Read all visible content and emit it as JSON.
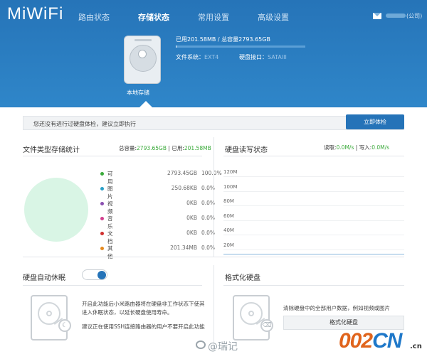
{
  "header": {
    "logo": "MiWiFi",
    "nav": [
      "路由状态",
      "存储状态",
      "常用设置",
      "高级设置"
    ],
    "active_nav": 1,
    "account_suffix": "(公司)"
  },
  "storage": {
    "caption": "本地存储",
    "usage_text": "已用201.58MB / 总容量2793.65GB",
    "used_fraction": 0.0001,
    "fs_label": "文件系统：",
    "fs_value": "EXT4",
    "interface_label": "硬盘接口：",
    "interface_value": "SATAIII"
  },
  "notice": {
    "text": "您还没有进行过硬盘体检，建议立即执行",
    "button": "立即体检"
  },
  "file_stats": {
    "title": "文件类型存储统计",
    "total_label": "总容量:",
    "total_value": "2793.65GB",
    "sep": "|",
    "used_label": "已用:",
    "used_value": "201.58MB",
    "colors": [
      "#3aaa3a",
      "#2aa0c8",
      "#8a4fb0",
      "#d23f8f",
      "#d0302f",
      "#e58a1f"
    ],
    "rows": [
      {
        "name": "可用",
        "size": "2793.45GB",
        "pct": "100.0%"
      },
      {
        "name": "图片",
        "size": "250.68KB",
        "pct": "0.0%"
      },
      {
        "name": "视频",
        "size": "0KB",
        "pct": "0.0%"
      },
      {
        "name": "音乐",
        "size": "0KB",
        "pct": "0.0%"
      },
      {
        "name": "文档",
        "size": "0KB",
        "pct": "0.0%"
      },
      {
        "name": "其他",
        "size": "201.34MB",
        "pct": "0.0%"
      }
    ]
  },
  "rw": {
    "title": "硬盘读写状态",
    "read_label": "读取:",
    "read_value": "0.0M/s",
    "sep": "|",
    "write_label": "写入:",
    "write_value": "0.0M/s",
    "ticks": [
      "120M",
      "100M",
      "80M",
      "60M",
      "40M",
      "20M"
    ]
  },
  "sleep": {
    "title": "硬盘自动休眠",
    "enabled": true,
    "desc1": "开启此功能后小米路由器将在硬盘非工作状态下使其",
    "desc2": "进入休眠状态，以延长硬盘使用寿命。",
    "desc3": "建议正在使用SSH连接路由器的用户不要开启此功能"
  },
  "format": {
    "title": "格式化硬盘",
    "desc": "清除硬盘中的全部用户数据，例如视频或图片",
    "button": "格式化硬盘"
  },
  "watermark": {
    "weibo": "@瑞记",
    "site_a": "002",
    "site_b": "CN",
    "tld": ".cn"
  }
}
